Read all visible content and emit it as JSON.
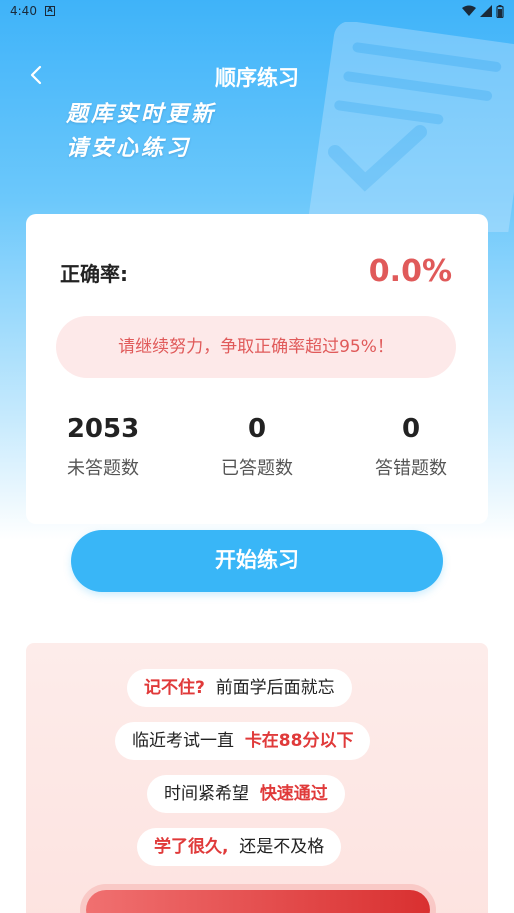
{
  "status_bar": {
    "time": "4:40",
    "a_badge": "A"
  },
  "header": {
    "title": "顺序练习"
  },
  "slogan": {
    "line1": "题库实时更新",
    "line2": "请安心练习"
  },
  "accuracy": {
    "label": "正确率:",
    "value": "0.0%",
    "tip": "请继续努力，争取正确率超过95%！"
  },
  "stats": [
    {
      "value": "2053",
      "label": "未答题数"
    },
    {
      "value": "0",
      "label": "已答题数"
    },
    {
      "value": "0",
      "label": "答错题数"
    }
  ],
  "start_button": "开始练习",
  "pain_points": [
    {
      "highlight": "记不住?",
      "text": "前面学后面就忘"
    },
    {
      "text": "临近考试一直",
      "highlight": "卡在88分以下"
    },
    {
      "text": "时间紧希望",
      "highlight": "快速通过"
    },
    {
      "highlight": "学了很久,",
      "text": "还是不及格"
    }
  ],
  "colors": {
    "primary": "#39b6f7",
    "accent_red": "#e05a5a",
    "highlight_red": "#e03a3a"
  }
}
